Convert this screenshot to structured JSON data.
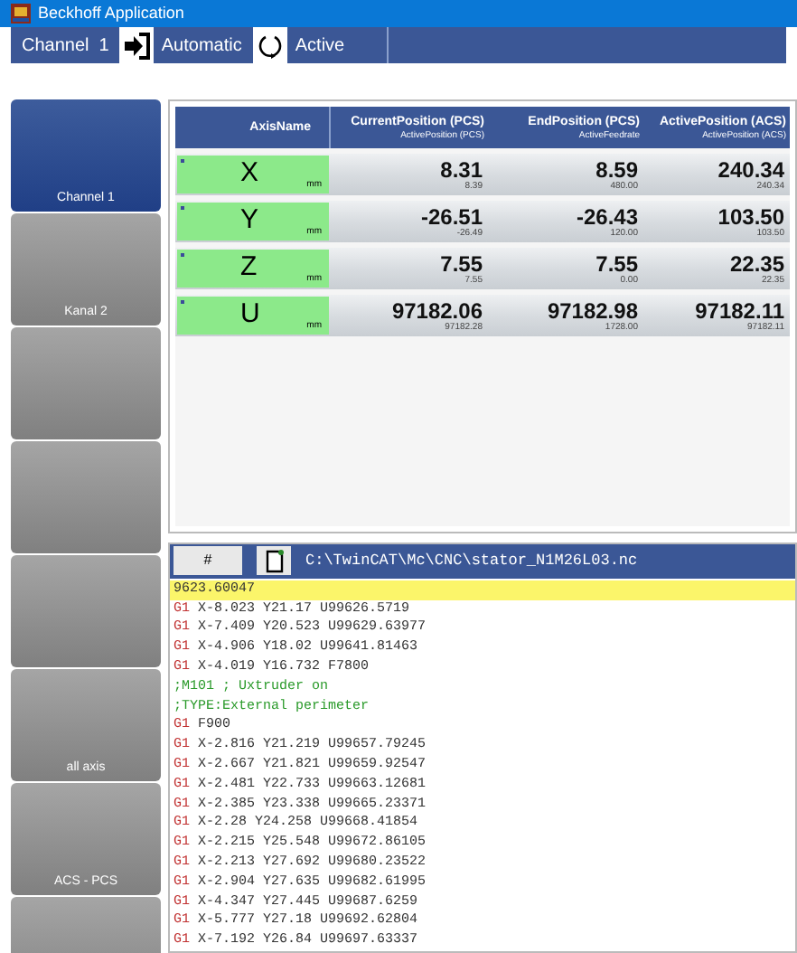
{
  "window": {
    "title": "Beckhoff Application"
  },
  "toolbar": {
    "channel": "Channel  1",
    "mode": "Automatic",
    "state": "Active"
  },
  "sidebar": {
    "items": [
      {
        "label": "Channel 1",
        "selected": true
      },
      {
        "label": "Kanal 2",
        "selected": false
      },
      {
        "selected": false
      },
      {
        "selected": false
      },
      {
        "selected": false
      },
      {
        "label": "all axis",
        "selected": false
      },
      {
        "label": "ACS - PCS",
        "selected": false
      },
      {
        "selected": false
      }
    ]
  },
  "axis_table": {
    "columns": [
      {
        "title": "AxisName"
      },
      {
        "title": "CurrentPosition (PCS)",
        "subtitle": "ActivePosition (PCS)"
      },
      {
        "title": "EndPosition (PCS)",
        "subtitle": "ActiveFeedrate"
      },
      {
        "title": "ActivePosition (ACS)",
        "subtitle": "ActivePosition (ACS)"
      }
    ],
    "rows": [
      {
        "axis": "X",
        "unit": "mm",
        "values": [
          {
            "main": "8.31",
            "sub": "8.39"
          },
          {
            "main": "8.59",
            "sub": "480.00"
          },
          {
            "main": "240.34",
            "sub": "240.34"
          }
        ]
      },
      {
        "axis": "Y",
        "unit": "mm",
        "values": [
          {
            "main": "-26.51",
            "sub": "-26.49"
          },
          {
            "main": "-26.43",
            "sub": "120.00"
          },
          {
            "main": "103.50",
            "sub": "103.50"
          }
        ]
      },
      {
        "axis": "Z",
        "unit": "mm",
        "values": [
          {
            "main": "7.55",
            "sub": "7.55"
          },
          {
            "main": "7.55",
            "sub": "0.00"
          },
          {
            "main": "22.35",
            "sub": "22.35"
          }
        ]
      },
      {
        "axis": "U",
        "unit": "mm",
        "values": [
          {
            "main": "97182.06",
            "sub": "97182.28"
          },
          {
            "main": "97182.98",
            "sub": "1728.00"
          },
          {
            "main": "97182.11",
            "sub": "97182.11"
          }
        ]
      }
    ]
  },
  "program": {
    "button": "#",
    "path": "C:\\TwinCAT\\Mc\\CNC\\stator_N1M26L03.nc",
    "lines": [
      {
        "kind": "plain",
        "text": "9623.60047",
        "selected": true
      },
      {
        "kind": "command",
        "code": "G1",
        "text": "X-8.023 Y21.17 U99626.5719",
        "selected": false
      },
      {
        "kind": "command",
        "code": "G1",
        "text": "X-7.409 Y20.523 U99629.63977",
        "selected": false
      },
      {
        "kind": "command",
        "code": "G1",
        "text": "X-4.906 Y18.02 U99641.81463",
        "selected": false
      },
      {
        "kind": "command",
        "code": "G1",
        "text": "X-4.019 Y16.732 F7800",
        "selected": false
      },
      {
        "kind": "comment",
        "text": ";M101 ; Uxtruder on",
        "selected": false
      },
      {
        "kind": "comment",
        "text": ";TYPE:External perimeter",
        "selected": false
      },
      {
        "kind": "command",
        "code": "G1",
        "text": "F900",
        "selected": false
      },
      {
        "kind": "command",
        "code": "G1",
        "text": "X-2.816 Y21.219 U99657.79245",
        "selected": false
      },
      {
        "kind": "command",
        "code": "G1",
        "text": "X-2.667 Y21.821 U99659.92547",
        "selected": false
      },
      {
        "kind": "command",
        "code": "G1",
        "text": "X-2.481 Y22.733 U99663.12681",
        "selected": false
      },
      {
        "kind": "command",
        "code": "G1",
        "text": "X-2.385 Y23.338 U99665.23371",
        "selected": false
      },
      {
        "kind": "command",
        "code": "G1",
        "text": "X-2.28 Y24.258 U99668.41854",
        "selected": false
      },
      {
        "kind": "command",
        "code": "G1",
        "text": "X-2.215 Y25.548 U99672.86105",
        "selected": false
      },
      {
        "kind": "command",
        "code": "G1",
        "text": "X-2.213 Y27.692 U99680.23522",
        "selected": false
      },
      {
        "kind": "command",
        "code": "G1",
        "text": "X-2.904 Y27.635 U99682.61995",
        "selected": false
      },
      {
        "kind": "command",
        "code": "G1",
        "text": "X-4.347 Y27.445 U99687.6259",
        "selected": false
      },
      {
        "kind": "command",
        "code": "G1",
        "text": "X-5.777 Y27.18 U99692.62804",
        "selected": false
      },
      {
        "kind": "command",
        "code": "G1",
        "text": "X-7.192 Y26.84 U99697.63337",
        "selected": false
      }
    ]
  }
}
